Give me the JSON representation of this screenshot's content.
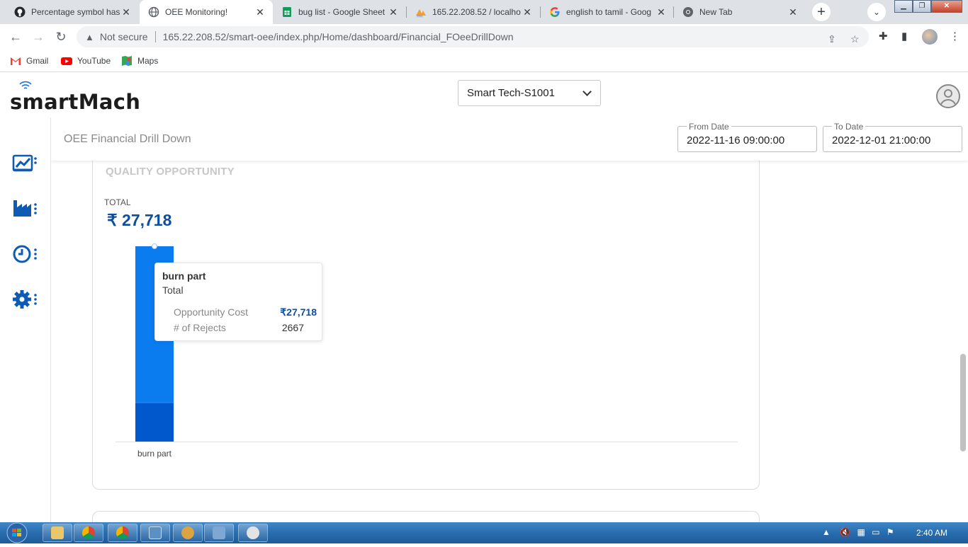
{
  "browser": {
    "tabs": [
      {
        "label": "Percentage symbol has",
        "icon": "github-icon",
        "active": false
      },
      {
        "label": "OEE Monitoring!",
        "icon": "globe-icon",
        "active": true
      },
      {
        "label": "bug list - Google Sheet",
        "icon": "sheets-icon",
        "active": false
      },
      {
        "label": "165.22.208.52 / localho",
        "icon": "phpmyadmin-icon",
        "active": false
      },
      {
        "label": "english to tamil - Goog",
        "icon": "google-icon",
        "active": false
      },
      {
        "label": "New Tab",
        "icon": "chrome-icon",
        "active": false
      }
    ],
    "address": {
      "security": "Not secure",
      "url": "165.22.208.52/smart-oee/index.php/Home/dashboard/Financial_FOeeDrillDown"
    },
    "bookmarks": [
      {
        "label": "Gmail",
        "icon": "gmail-icon"
      },
      {
        "label": "YouTube",
        "icon": "youtube-icon"
      },
      {
        "label": "Maps",
        "icon": "maps-icon"
      }
    ]
  },
  "app": {
    "logo": "smartMach",
    "plant_select": "Smart Tech-S1001",
    "page_title": "OEE Financial Drill Down",
    "from_date": {
      "label": "From Date",
      "value": "2022-11-16 09:00:00"
    },
    "to_date": {
      "label": "To Date",
      "value": "2022-12-01 21:00:00"
    },
    "sidebar": [
      "chart-icon",
      "factory-icon",
      "clock-icon",
      "settings-icon"
    ],
    "card": {
      "title": "QUALITY OPPORTUNITY",
      "total_label": "TOTAL",
      "total_value": "₹ 27,718"
    },
    "tooltip": {
      "title": "burn part",
      "subtitle": "Total",
      "rows": [
        {
          "key": "Opportunity Cost",
          "value": "₹27,718"
        },
        {
          "key": "# of Rejects",
          "value": "2667"
        }
      ]
    }
  },
  "chart_data": {
    "type": "bar",
    "categories": [
      "burn part"
    ],
    "series": [
      {
        "values": [
          0.8
        ],
        "color": "#0a7cf0"
      },
      {
        "values": [
          0.2
        ],
        "color": "#0059cc"
      }
    ],
    "total_opportunity_cost": 27718,
    "rejects": 2667,
    "stacked": true
  },
  "taskbar": {
    "clock": "2:40 AM"
  }
}
